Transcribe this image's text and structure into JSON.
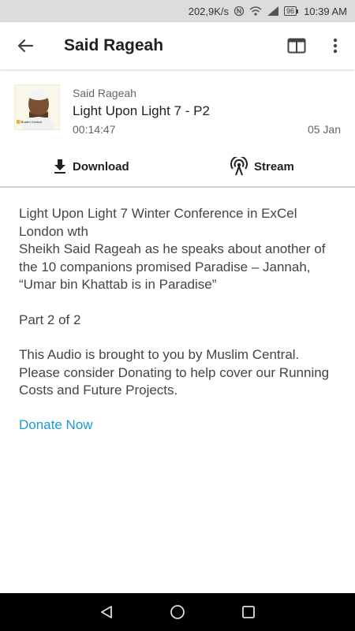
{
  "status_bar": {
    "speed": "202,9K/s",
    "battery": "96",
    "time": "10:39 AM"
  },
  "toolbar": {
    "title": "Said Rageah"
  },
  "episode": {
    "thumbnail_caption": "Muslim Central",
    "author": "Said Rageah",
    "title": "Light Upon Light 7 - P2",
    "duration": "00:14:47",
    "date": "05 Jan"
  },
  "actions": {
    "download_label": "Download",
    "stream_label": "Stream"
  },
  "description": {
    "para1_line1": "Light Upon Light 7 Winter Conference in ExCel London wth",
    "para1_line2": "Sheikh Said Rageah as he speaks about another of the 10 companions promised Paradise – Jannah, “Umar bin Khattab is in Paradise”",
    "para2": "Part 2 of 2",
    "para3": "This Audio is brought to you by Muslim Central. Please consider Donating to help cover our Running Costs and Future Projects.",
    "donate_link": "Donate Now"
  },
  "colors": {
    "link": "#1a9bd6",
    "status_bar_bg": "#dcdcdc",
    "nav_bar_bg": "#000000"
  }
}
